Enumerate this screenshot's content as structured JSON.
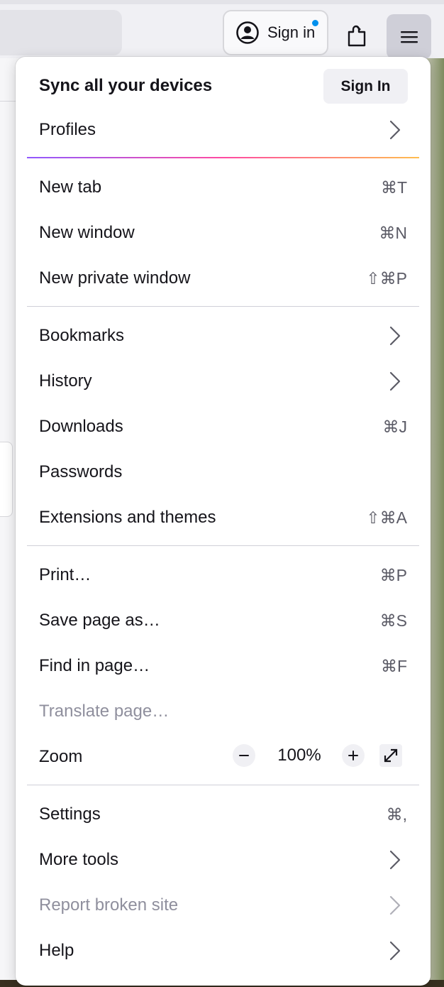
{
  "toolbar": {
    "signin_label": "Sign in"
  },
  "account": {
    "sync_title": "Sync all your devices",
    "signin_button": "Sign In",
    "profiles_label": "Profiles"
  },
  "menu": {
    "new_tab": {
      "label": "New tab",
      "shortcut": "⌘T"
    },
    "new_window": {
      "label": "New window",
      "shortcut": "⌘N"
    },
    "new_private_window": {
      "label": "New private window",
      "shortcut": "⇧⌘P"
    },
    "bookmarks": {
      "label": "Bookmarks"
    },
    "history": {
      "label": "History"
    },
    "downloads": {
      "label": "Downloads",
      "shortcut": "⌘J"
    },
    "passwords": {
      "label": "Passwords"
    },
    "extensions": {
      "label": "Extensions and themes",
      "shortcut": "⇧⌘A"
    },
    "print": {
      "label": "Print…",
      "shortcut": "⌘P"
    },
    "save_page": {
      "label": "Save page as…",
      "shortcut": "⌘S"
    },
    "find_in_page": {
      "label": "Find in page…",
      "shortcut": "⌘F"
    },
    "translate_page": {
      "label": "Translate page…"
    },
    "zoom": {
      "label": "Zoom",
      "value": "100%"
    },
    "settings": {
      "label": "Settings",
      "shortcut": "⌘,"
    },
    "more_tools": {
      "label": "More tools"
    },
    "report_broken_site": {
      "label": "Report broken site"
    },
    "help": {
      "label": "Help"
    }
  },
  "colors": {
    "accent_dot": "#0090ed",
    "disabled_text": "#8f8f9d"
  }
}
